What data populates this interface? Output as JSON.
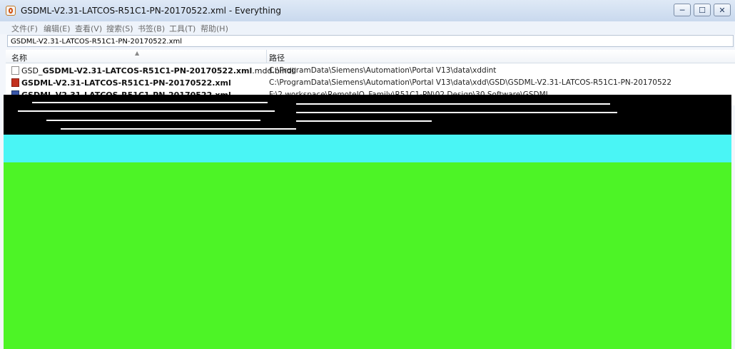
{
  "window": {
    "title": "GSDML-V2.31-LATCOS-R51C1-PN-20170522.xml - Everything",
    "controls": {
      "minimize": "─",
      "maximize": "☐",
      "close": "✕"
    }
  },
  "menu": [
    {
      "label": "文件(F)"
    },
    {
      "label": "编辑(E)"
    },
    {
      "label": "查看(V)"
    },
    {
      "label": "搜索(S)"
    },
    {
      "label": "书签(B)"
    },
    {
      "label": "工具(T)"
    },
    {
      "label": "帮助(H)"
    }
  ],
  "search": {
    "value": "GSDML-V2.31-LATCOS-R51C1-PN-20170522.xml"
  },
  "columns": {
    "name": "名称",
    "path": "路径"
  },
  "results": [
    {
      "name_prefix": "GSD_",
      "name_bold": "GSDML-V2.31-LATCOS-R51C1-PN-20170522.xml",
      "name_suffix": ".mdd.bindll",
      "path": "C:\\ProgramData\\Siemens\\Automation\\Portal V13\\data\\xddint",
      "icon": "document-icon"
    },
    {
      "name_prefix": "",
      "name_bold": "GSDML-V2.31-LATCOS-R51C1-PN-20170522.xml",
      "name_suffix": "",
      "path": "C:\\ProgramData\\Siemens\\Automation\\Portal V13\\data\\xdd\\GSD\\GSDML-V2.31-LATCOS-R51C1-PN-20170522",
      "icon": "xml-file-icon"
    },
    {
      "name_prefix": "",
      "name_bold": "GSDML-V2.31-LATCOS-R51C1-PN-20170522.xml",
      "name_suffix": "",
      "path": "F:\\2 workspace\\RemoteIO_Family\\R51C1-PN\\02 Design\\30 Software\\GSDML",
      "icon": "xml-file-icon"
    }
  ]
}
